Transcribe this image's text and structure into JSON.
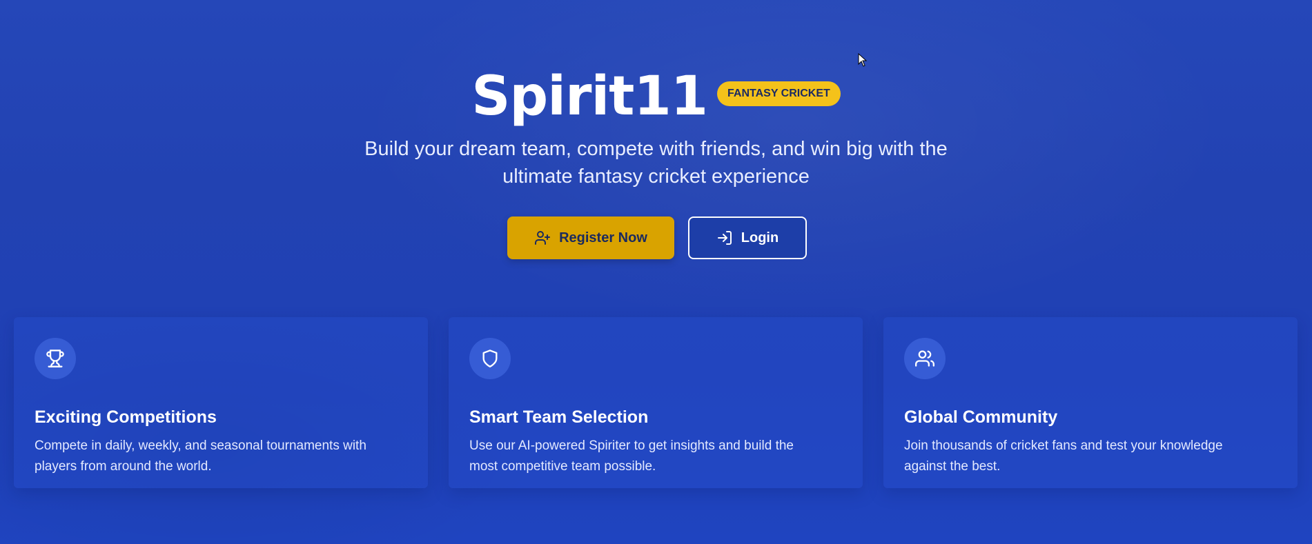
{
  "hero": {
    "brand": "Spirit11",
    "badge": "FANTASY CRICKET",
    "tagline_line1": "Build your dream team, compete with friends, and win big with the",
    "tagline_line2": "ultimate fantasy cricket experience"
  },
  "cta": {
    "register_label": "Register Now",
    "register_icon": "user-plus-icon",
    "login_label": "Login",
    "login_icon": "log-in-icon"
  },
  "features": [
    {
      "icon": "trophy-icon",
      "title": "Exciting Competitions",
      "text_line1": "Compete in daily, weekly, and seasonal tournaments with",
      "text_line2": "players from around the world."
    },
    {
      "icon": "shield-icon",
      "title": "Smart Team Selection",
      "text_line1": "Use our AI-powered Spiriter to get insights and build the",
      "text_line2": "most competitive team possible."
    },
    {
      "icon": "users-icon",
      "title": "Global Community",
      "text_line1": "Join thousands of cricket fans and test your knowledge",
      "text_line2": "against the best."
    }
  ],
  "colors": {
    "background": "#2344b5",
    "accent_yellow": "#f4c21a",
    "primary_button": "#d9a300",
    "text_dark": "#1a2a5e"
  }
}
